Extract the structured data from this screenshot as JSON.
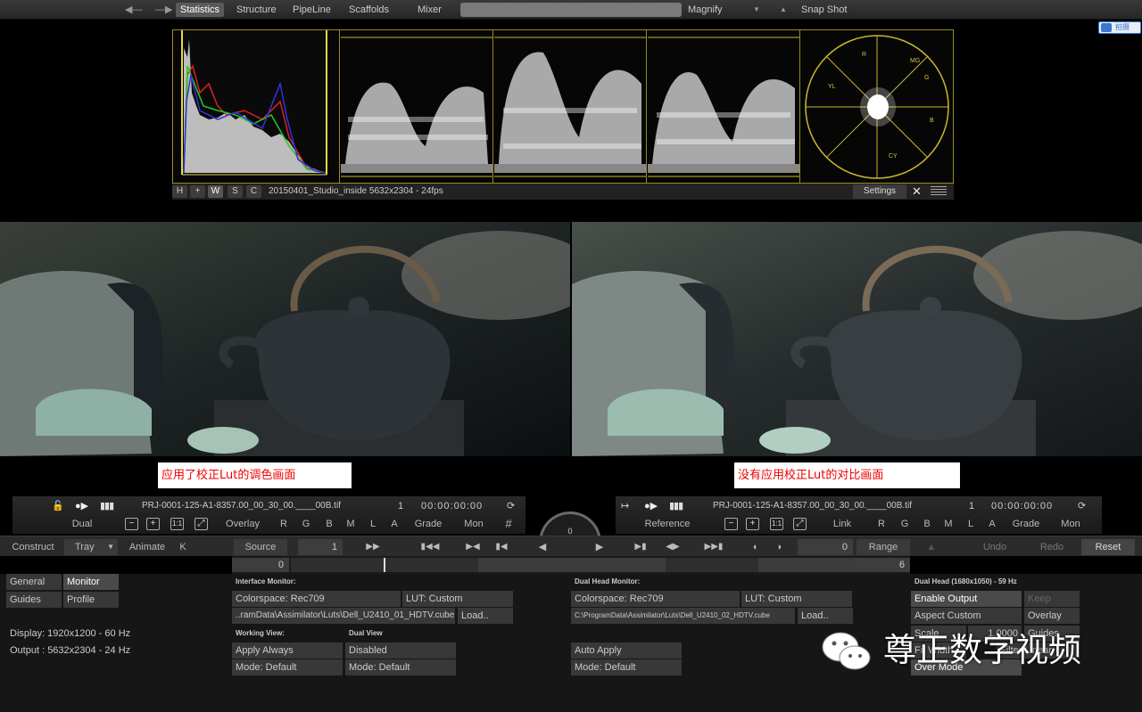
{
  "topbar": {
    "back_icon": "arrow-left-icon",
    "forward_icon": "arrow-right-icon",
    "tabs": [
      "Statistics",
      "Structure",
      "PipeLine",
      "Scaffolds",
      "Mixer"
    ],
    "magnify_label": "Magnify",
    "snapshot_label": "Snap Shot",
    "right_badge": "拍摄"
  },
  "scopes": {
    "buttons": [
      "H",
      "+",
      "W",
      "S",
      "C"
    ],
    "clip_info": "20150401_Studio_inside 5632x2304 - 24fps",
    "settings_label": "Settings",
    "close_glyph": "✕",
    "vector_labels": [
      "R",
      "MG",
      "B",
      "CY",
      "G",
      "YL"
    ]
  },
  "viewers": {
    "left_caption": "应用了校正Lut的调色画面",
    "right_caption": "没有应用校正Lut的对比画面"
  },
  "monitor_left": {
    "clip_name": "PRJ-0001-125-A1-8357.00_00_30_00.____00B.tif",
    "frame": "1",
    "timecode": "00:00:00:00",
    "mode_label": "Dual",
    "overlay_label": "Overlay",
    "channels": [
      "R",
      "G",
      "B",
      "M",
      "L",
      "A"
    ],
    "grade_label": "Grade",
    "mon_label": "Mon",
    "zoom_buttons": [
      "−",
      "+",
      "1:1",
      "⤢"
    ]
  },
  "monitor_right": {
    "clip_name": "PRJ-0001-125-A1-8357.00_00_30_00.____00B.tif",
    "frame": "1",
    "timecode": "00:00:00:00",
    "mode_label": "Reference",
    "link_label": "Link",
    "channels": [
      "R",
      "G",
      "B",
      "M",
      "L",
      "A"
    ],
    "grade_label": "Grade",
    "mon_label": "Mon",
    "zoom_buttons": [
      "−",
      "+",
      "1:1",
      "⤢"
    ]
  },
  "dial_value": "0",
  "transport": {
    "construct": "Construct",
    "tray": "Tray",
    "animate": "Animate",
    "k": "K",
    "source": "Source",
    "source_value": "1",
    "frame_value": "0",
    "range": "Range",
    "undo": "Undo",
    "redo": "Redo",
    "reset": "Reset",
    "timeline_start": "0",
    "timeline_end": "6"
  },
  "panel": {
    "nav": [
      "General",
      "Monitor",
      "Guides",
      "Profile"
    ],
    "display_info": "Display: 1920x1200 - 60 Hz",
    "output_info": "Output : 5632x2304 - 24 Hz",
    "interface_monitor": {
      "heading": "Interface Monitor:",
      "colorspace": "Colorspace: Rec709",
      "lut": "LUT: Custom",
      "lut_path": "..ramData\\Assimilator\\Luts\\Dell_U2410_01_HDTV.cube",
      "load": "Load.."
    },
    "working_view": {
      "heading": "Working View:",
      "apply": "Apply Always",
      "mode": "Mode: Default"
    },
    "dual_view": {
      "heading": "Dual View",
      "state": "Disabled",
      "mode": "Mode: Default"
    },
    "dual_head_monitor": {
      "heading": "Dual Head Monitor:",
      "colorspace": "Colorspace: Rec709",
      "lut": "LUT: Custom",
      "lut_path": "C:\\ProgramData\\Assimilator\\Luts\\Dell_U2410_02_HDTV.cube",
      "load": "Load..",
      "apply": "Auto Apply",
      "mode": "Mode: Default"
    },
    "dual_head": {
      "heading": "Dual Head (1680x1050) - 59 Hz",
      "enable": "Enable Output",
      "keep": "Keep",
      "aspect": "Aspect Custom",
      "overlay": "Overlay",
      "scale": "Scale",
      "scale_value": "1.0000",
      "guides": "Guides",
      "fit_width": "Fit Width",
      "filter_linear": "Filter Linear",
      "over_mode": "Over Mode"
    }
  },
  "watermark": {
    "icon": "wechat-icon",
    "text": "尊正数字视频"
  }
}
